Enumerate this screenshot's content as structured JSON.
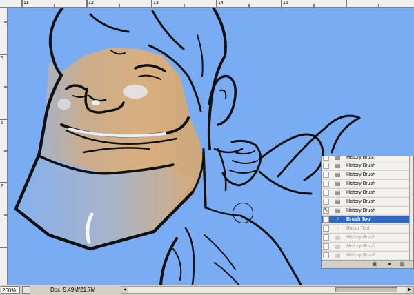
{
  "ruler": {
    "top_labels": [
      "11",
      "12",
      "13",
      "14",
      "15"
    ],
    "left_labels": [
      "5",
      "6",
      "7"
    ]
  },
  "status": {
    "zoom": "200%",
    "doc_info": "Doc: 5.49M/21.7M"
  },
  "history": {
    "items": [
      {
        "label": "History Brush",
        "state": "past",
        "icon": "history-brush-icon"
      },
      {
        "label": "History Brush",
        "state": "past",
        "icon": "history-brush-icon"
      },
      {
        "label": "History Brush",
        "state": "past",
        "icon": "history-brush-icon"
      },
      {
        "label": "History Brush",
        "state": "past",
        "icon": "history-brush-icon"
      },
      {
        "label": "History Brush",
        "state": "past",
        "icon": "history-brush-icon"
      },
      {
        "label": "History Brush",
        "state": "past",
        "icon": "history-brush-icon"
      },
      {
        "label": "History Brush",
        "state": "past",
        "icon": "history-brush-icon"
      },
      {
        "label": "Brush Tool",
        "state": "selected",
        "icon": "brush-icon"
      },
      {
        "label": "Brush Tool",
        "state": "future",
        "icon": "brush-icon"
      },
      {
        "label": "History Brush",
        "state": "future",
        "icon": "history-brush-icon"
      },
      {
        "label": "History Brush",
        "state": "future",
        "icon": "history-brush-icon"
      },
      {
        "label": "History Brush",
        "state": "future",
        "icon": "history-brush-icon"
      }
    ],
    "footer_icons": [
      "new-document-icon",
      "camera-icon",
      "trash-icon"
    ]
  },
  "colors": {
    "canvas_bg": "#79acf2",
    "skin": "#d9ae7e",
    "selection": "#316ac5"
  }
}
